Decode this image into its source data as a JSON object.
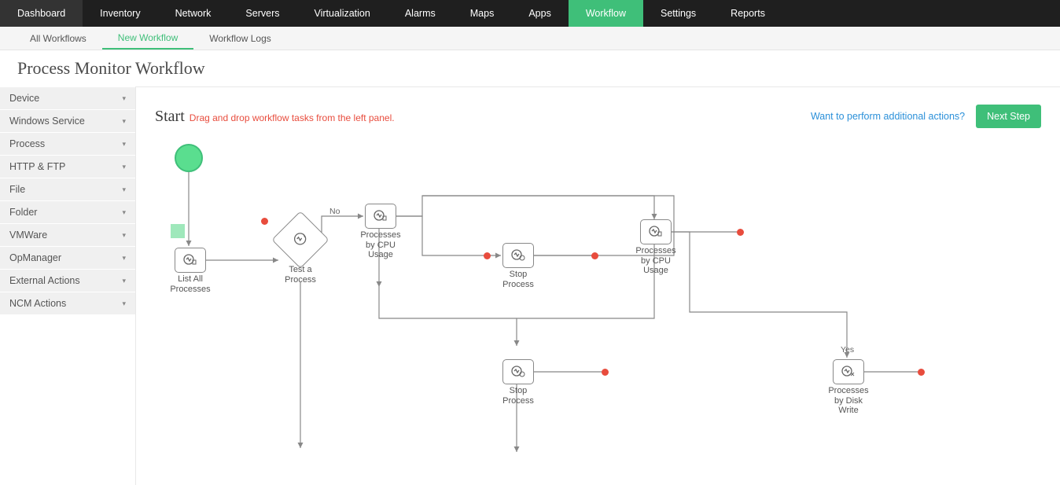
{
  "topNav": {
    "items": [
      "Dashboard",
      "Inventory",
      "Network",
      "Servers",
      "Virtualization",
      "Alarms",
      "Maps",
      "Apps",
      "Workflow",
      "Settings",
      "Reports"
    ],
    "activeIndex": 8
  },
  "subNav": {
    "items": [
      "All Workflows",
      "New Workflow",
      "Workflow Logs"
    ],
    "activeIndex": 1
  },
  "page": {
    "title": "Process Monitor Workflow"
  },
  "sidebar": {
    "items": [
      "Device",
      "Windows Service",
      "Process",
      "HTTP & FTP",
      "File",
      "Folder",
      "VMWare",
      "OpManager",
      "External Actions",
      "NCM Actions"
    ]
  },
  "canvas": {
    "startLabel": "Start",
    "hint": "Drag and drop workflow tasks from the left panel.",
    "extraLink": "Want to perform additional actions?",
    "nextBtn": "Next Step"
  },
  "flow": {
    "nodes": {
      "listAll": {
        "label": "List All Processes"
      },
      "testProcess": {
        "label": "Test a Process"
      },
      "cpu1": {
        "label": "Processes by CPU Usage"
      },
      "stop1": {
        "label": "Stop Process"
      },
      "cpu2": {
        "label": "Processes by CPU Usage"
      },
      "stop2": {
        "label": "Stop Process"
      },
      "diskWrite": {
        "label": "Processes by Disk Write"
      }
    },
    "branchLabels": {
      "no": "No",
      "yes": "Yes"
    }
  }
}
